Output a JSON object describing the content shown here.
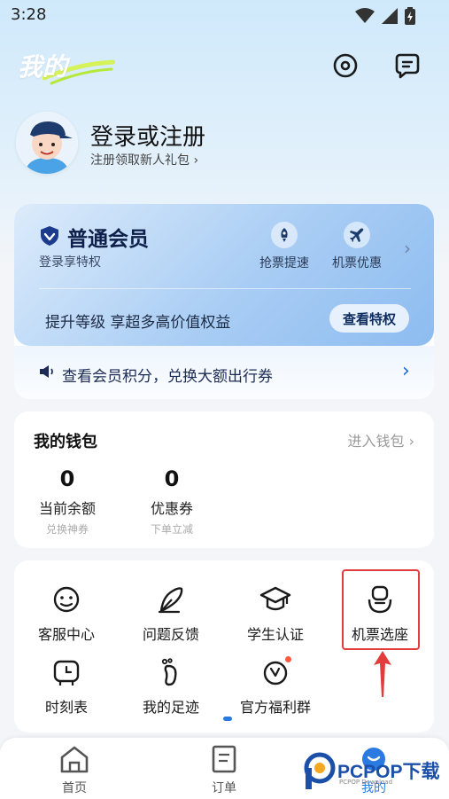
{
  "status_bar": {
    "time": "3:28"
  },
  "header": {
    "title": "我的"
  },
  "profile": {
    "title": "登录或注册",
    "subtitle": "注册领取新人礼包 ›"
  },
  "member": {
    "title": "普通会员",
    "subtitle": "登录享特权",
    "perks": [
      {
        "label": "抢票提速",
        "icon": "rocket-icon"
      },
      {
        "label": "机票优惠",
        "icon": "airplane-icon"
      }
    ],
    "upgrade_text": "提升等级 享超多高价值权益",
    "perks_button": "查看特权",
    "points_text": "查看会员积分，兑换大额出行券"
  },
  "wallet": {
    "title": "我的钱包",
    "enter_label": "进入钱包 ›",
    "items": [
      {
        "value": "0",
        "label": "当前余额",
        "sub": "兑换神券"
      },
      {
        "value": "0",
        "label": "优惠券",
        "sub": "下单立减"
      }
    ]
  },
  "services": [
    {
      "label": "客服中心",
      "icon": "customer-service-icon"
    },
    {
      "label": "问题反馈",
      "icon": "feedback-icon"
    },
    {
      "label": "学生认证",
      "icon": "graduation-cap-icon"
    },
    {
      "label": "机票选座",
      "icon": "seat-icon"
    },
    {
      "label": "时刻表",
      "icon": "clock-icon"
    },
    {
      "label": "我的足迹",
      "icon": "footprint-icon"
    },
    {
      "label": "官方福利群",
      "icon": "welfare-group-icon"
    }
  ],
  "bottom_nav": [
    {
      "label": "首页",
      "icon": "home-icon"
    },
    {
      "label": "订单",
      "icon": "order-icon"
    },
    {
      "label": "我的",
      "icon": "profile-icon"
    }
  ],
  "watermark": {
    "text": "PCPOP下载",
    "sub": "PCPOP Download"
  },
  "colors": {
    "accent": "#2a7ae2",
    "highlight": "#e23c3c",
    "member_text": "#0e1f4a"
  }
}
